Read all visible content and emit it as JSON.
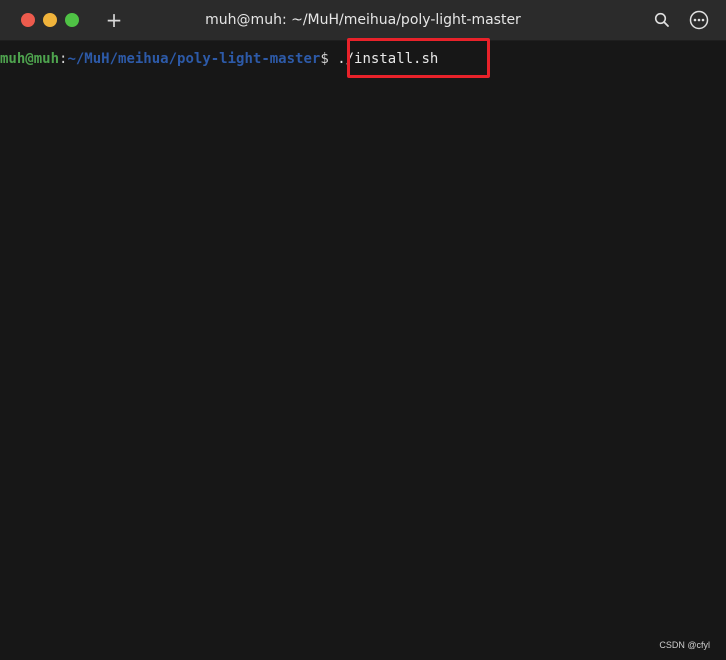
{
  "window": {
    "title": "muh@muh: ~/MuH/meihua/poly-light-master",
    "controls": {
      "close_color": "#ed5b4d",
      "minimize_color": "#f0b33b",
      "maximize_color": "#4fc245"
    },
    "new_tab_label": "+",
    "search_icon": "search-icon",
    "menu_icon": "more-options-icon"
  },
  "terminal": {
    "user_host": "muh@muh",
    "colon": ":",
    "path": "~/MuH/meihua/poly-light-master",
    "dollar": "$",
    "command": " ./install.sh",
    "highlight_color": "#e8222a"
  },
  "watermark": "CSDN @cfyl"
}
